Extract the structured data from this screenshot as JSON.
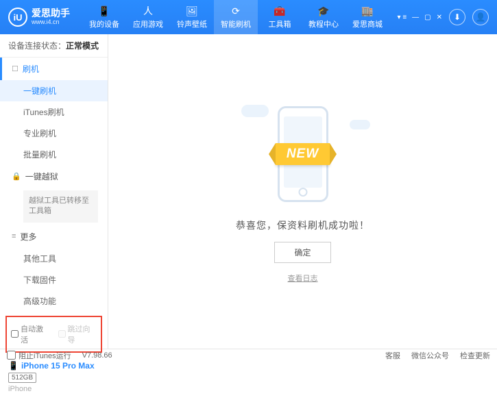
{
  "header": {
    "logo_letter": "iU",
    "app_name": "爱思助手",
    "app_url": "www.i4.cn",
    "nav": [
      {
        "label": "我的设备",
        "icon": "📱"
      },
      {
        "label": "应用游戏",
        "icon": "人"
      },
      {
        "label": "铃声壁纸",
        "icon": "🖼"
      },
      {
        "label": "智能刷机",
        "icon": "⟳"
      },
      {
        "label": "工具箱",
        "icon": "🧰"
      },
      {
        "label": "教程中心",
        "icon": "🎓"
      },
      {
        "label": "爱思商城",
        "icon": "🏬"
      }
    ],
    "active_nav_index": 3,
    "download_icon": "⬇",
    "user_icon": "👤"
  },
  "sidebar": {
    "status_label": "设备连接状态：",
    "status_value": "正常模式",
    "section_flash": {
      "icon": "☐",
      "label": "刷机"
    },
    "flash_items": [
      "一键刷机",
      "iTunes刷机",
      "专业刷机",
      "批量刷机"
    ],
    "active_flash_index": 0,
    "section_jailbreak": {
      "icon": "🔒",
      "label": "一键越狱"
    },
    "jailbreak_note": "越狱工具已转移至工具箱",
    "section_more": {
      "icon": "≡",
      "label": "更多"
    },
    "more_items": [
      "其他工具",
      "下载固件",
      "高级功能"
    ],
    "checks": {
      "auto_activate": "自动激活",
      "skip_guide": "跳过向导"
    },
    "device": {
      "name": "iPhone 15 Pro Max",
      "storage": "512GB",
      "type": "iPhone",
      "icon": "📱"
    }
  },
  "main": {
    "ribbon_text": "NEW",
    "message": "恭喜您，保资料刷机成功啦！",
    "ok_label": "确定",
    "log_link": "查看日志"
  },
  "footer": {
    "block_itunes": "阻止iTunes运行",
    "version": "V7.98.66",
    "links": [
      "客服",
      "微信公众号",
      "检查更新"
    ]
  }
}
